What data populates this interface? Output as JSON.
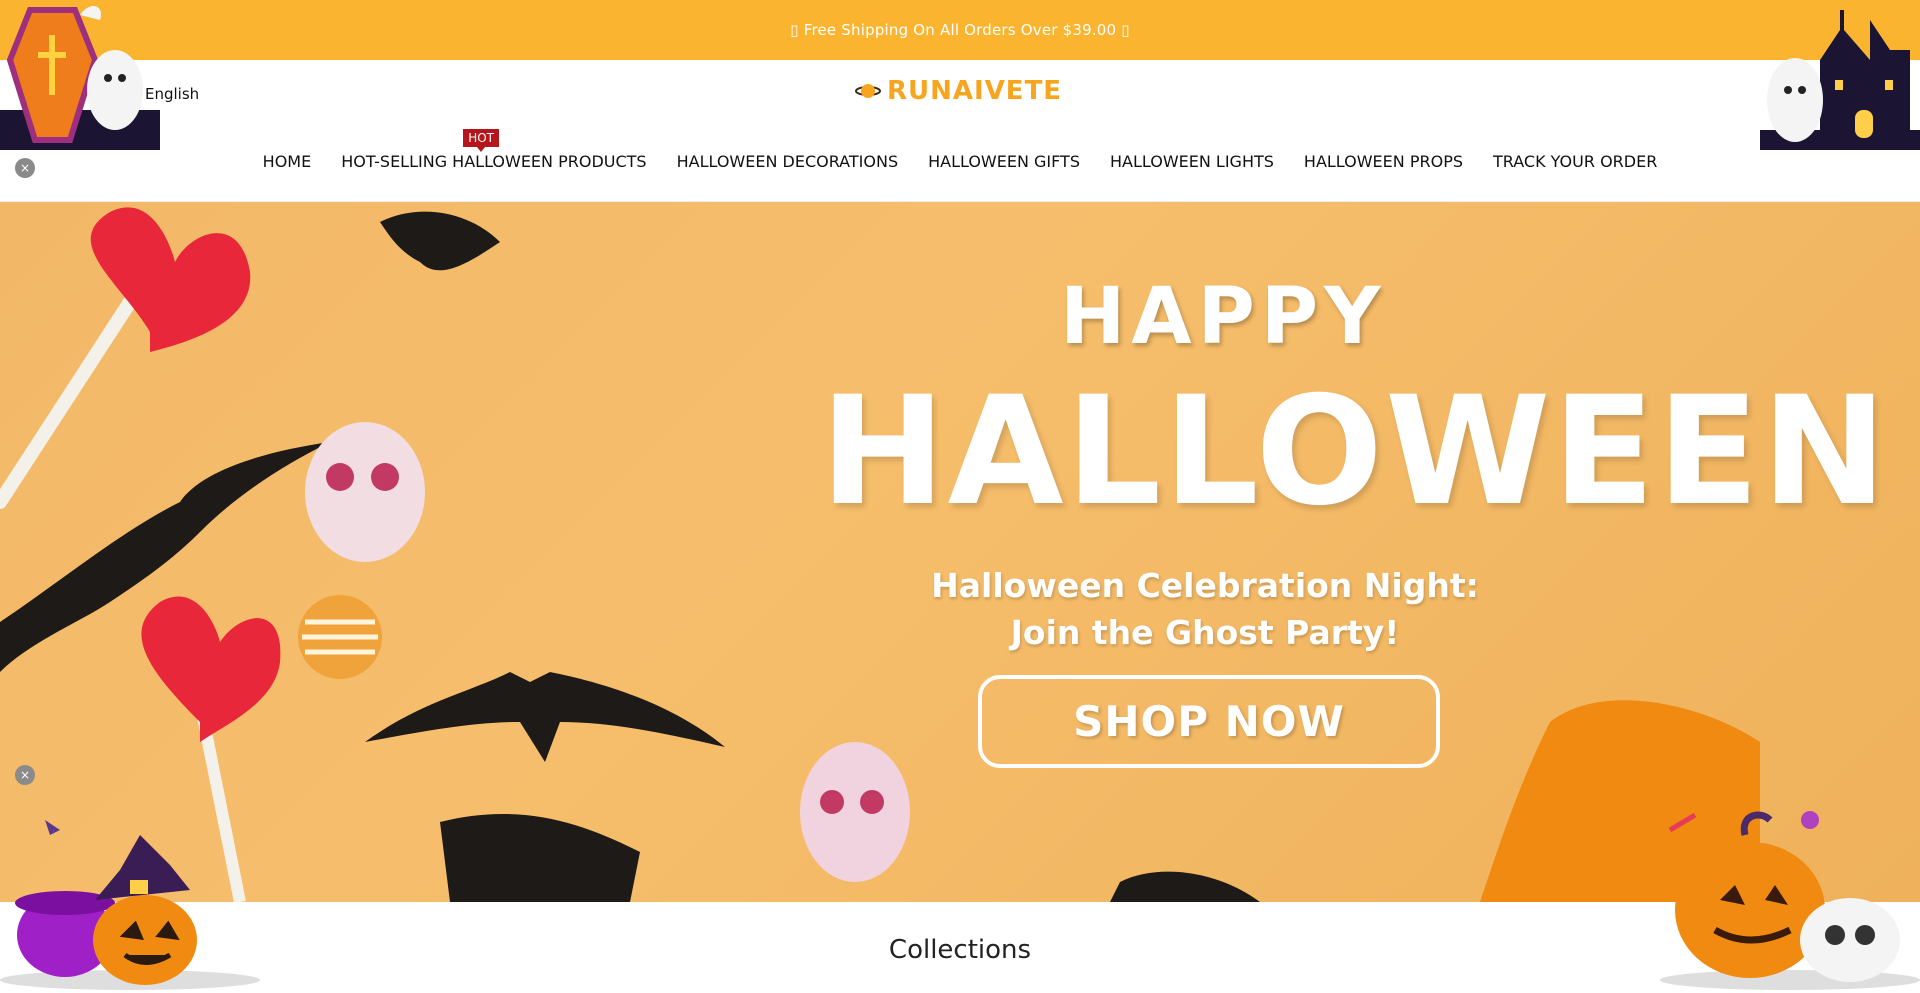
{
  "announcement": {
    "text": "▯ Free Shipping On All Orders Over $39.00 ▯"
  },
  "header": {
    "language": "English",
    "logo_text": "RUNAIVETE"
  },
  "nav": {
    "items": [
      {
        "label": "HOME"
      },
      {
        "label": "HOT-SELLING HALLOWEEN PRODUCTS",
        "badge": "HOT"
      },
      {
        "label": "HALLOWEEN DECORATIONS"
      },
      {
        "label": "HALLOWEEN GIFTS"
      },
      {
        "label": "HALLOWEEN LIGHTS"
      },
      {
        "label": "HALLOWEEN PROPS"
      },
      {
        "label": "TRACK YOUR ORDER"
      }
    ]
  },
  "hero": {
    "happy": "HAPPY",
    "title": "HALLOWEEN",
    "subtitle_line1": "Halloween Celebration Night:",
    "subtitle_line2": "Join the Ghost Party!",
    "cta": "SHOP NOW"
  },
  "collections": {
    "heading": "Collections"
  },
  "close_icon_glyph": "×",
  "colors": {
    "accent": "#fbb42f",
    "hot_badge": "#b5151b",
    "logo": "#f7a51f"
  }
}
